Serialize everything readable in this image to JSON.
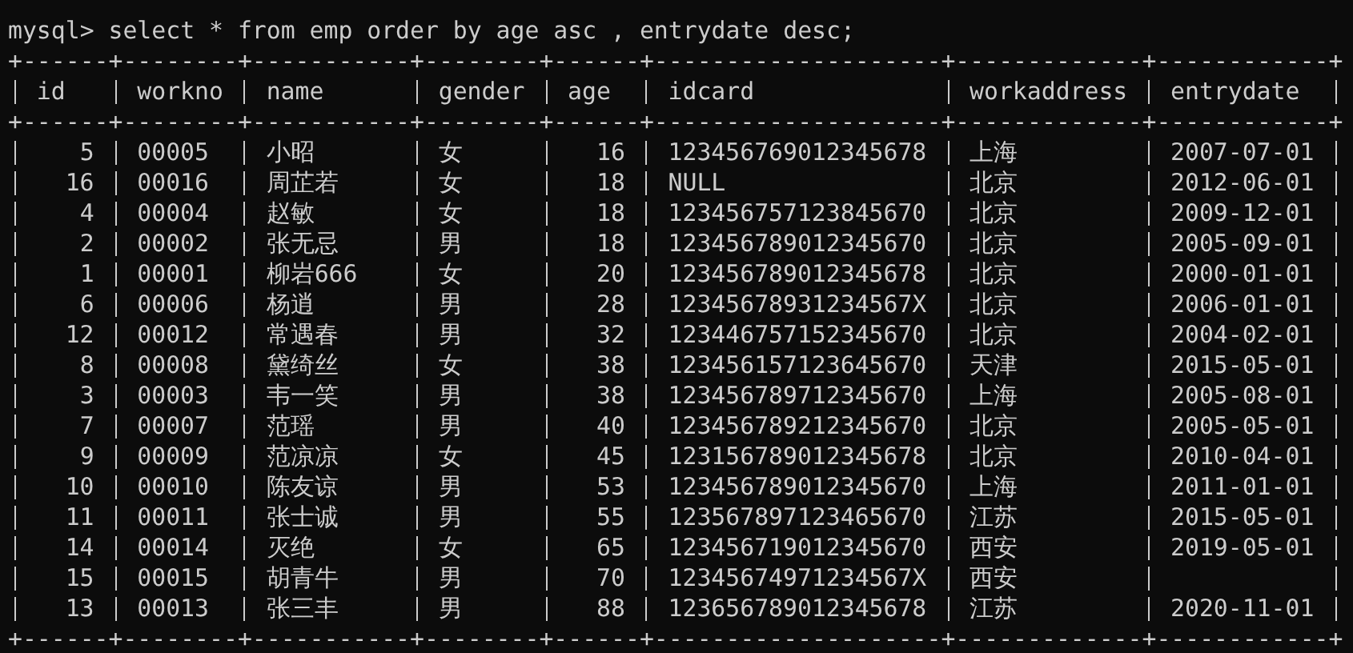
{
  "command": "mysql> select * from emp order by age asc , entrydate desc;",
  "borders": {
    "top": "+------+--------+-----------+--------+------+--------------------+-------------+------------+",
    "header": "+------+--------+-----------+--------+------+--------------------+-------------+------------+",
    "bottom": "+------+--------+-----------+--------+------+--------------------+-------------+------------+"
  },
  "columns": [
    "id",
    "workno",
    "name",
    "gender",
    "age",
    "idcard",
    "workaddress",
    "entrydate"
  ],
  "rows": [
    [
      "5",
      "00005",
      "小昭",
      "女",
      "16",
      "123456769012345678",
      "上海",
      "2007-07-01"
    ],
    [
      "16",
      "00016",
      "周芷若",
      "女",
      "18",
      "NULL",
      "北京",
      "2012-06-01"
    ],
    [
      "4",
      "00004",
      "赵敏",
      "女",
      "18",
      "123456757123845670",
      "北京",
      "2009-12-01"
    ],
    [
      "2",
      "00002",
      "张无忌",
      "男",
      "18",
      "123456789012345670",
      "北京",
      "2005-09-01"
    ],
    [
      "1",
      "00001",
      "柳岩666",
      "女",
      "20",
      "123456789012345678",
      "北京",
      "2000-01-01"
    ],
    [
      "6",
      "00006",
      "杨逍",
      "男",
      "28",
      "12345678931234567X",
      "北京",
      "2006-01-01"
    ],
    [
      "12",
      "00012",
      "常遇春",
      "男",
      "32",
      "123446757152345670",
      "北京",
      "2004-02-01"
    ],
    [
      "8",
      "00008",
      "黛绮丝",
      "女",
      "38",
      "123456157123645670",
      "天津",
      "2015-05-01"
    ],
    [
      "3",
      "00003",
      "韦一笑",
      "男",
      "38",
      "123456789712345670",
      "上海",
      "2005-08-01"
    ],
    [
      "7",
      "00007",
      "范瑶",
      "男",
      "40",
      "123456789212345670",
      "北京",
      "2005-05-01"
    ],
    [
      "9",
      "00009",
      "范凉凉",
      "女",
      "45",
      "123156789012345678",
      "北京",
      "2010-04-01"
    ],
    [
      "10",
      "00010",
      "陈友谅",
      "男",
      "53",
      "123456789012345670",
      "上海",
      "2011-01-01"
    ],
    [
      "11",
      "00011",
      "张士诚",
      "男",
      "55",
      "123567897123465670",
      "江苏",
      "2015-05-01"
    ],
    [
      "14",
      "00014",
      "灭绝",
      "女",
      "65",
      "123456719012345670",
      "西安",
      "2019-05-01"
    ],
    [
      "15",
      "00015",
      "胡青牛",
      "男",
      "70",
      "12345674971234567X",
      "西安"
    ],
    [
      "13",
      "00013",
      "张三丰",
      "男",
      "88",
      "123656789012345678",
      "江苏",
      "2020-11-01"
    ]
  ]
}
